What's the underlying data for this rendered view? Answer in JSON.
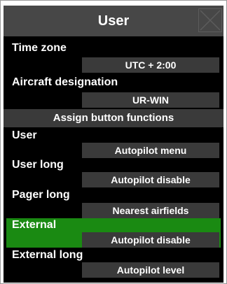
{
  "window": {
    "title": "User",
    "close_icon": "close-x-icon"
  },
  "fields": {
    "time_zone": {
      "label": "Time zone",
      "value": "UTC + 2:00"
    },
    "aircraft_designation": {
      "label": "Aircraft designation",
      "value": "UR-WIN"
    }
  },
  "assign_button_functions": {
    "label": "Assign button functions"
  },
  "assignments": [
    {
      "label": "User",
      "value": "Autopilot menu",
      "selected": false
    },
    {
      "label": "User long",
      "value": "Autopilot disable",
      "selected": false
    },
    {
      "label": "Pager long",
      "value": "Nearest airfields",
      "selected": false
    },
    {
      "label": "External",
      "value": "Autopilot disable",
      "selected": true
    },
    {
      "label": "External long",
      "value": "Autopilot level",
      "selected": false
    }
  ],
  "colors": {
    "background": "#000000",
    "titlebar": "#474747",
    "value_button": "#3a3a3a",
    "selected_row": "#1a8a12",
    "text": "#ffffff"
  }
}
